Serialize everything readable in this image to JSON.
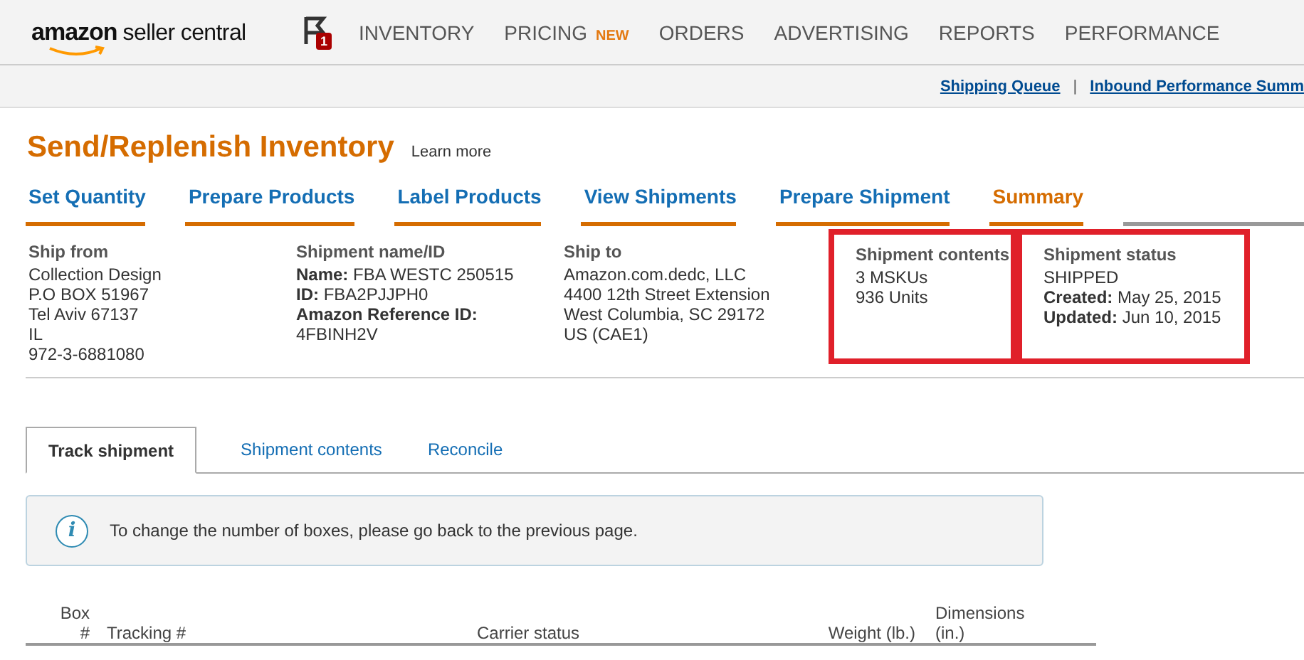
{
  "header": {
    "logo_main": "amazon",
    "logo_sub": "seller central",
    "flag_badge": "1",
    "nav": [
      {
        "label": "INVENTORY"
      },
      {
        "label": "PRICING",
        "badge": "NEW"
      },
      {
        "label": "ORDERS"
      },
      {
        "label": "ADVERTISING"
      },
      {
        "label": "REPORTS"
      },
      {
        "label": "PERFORMANCE"
      }
    ],
    "links": [
      "Shipping Queue",
      "Inbound Performance Summ"
    ],
    "link_separator": "|"
  },
  "page": {
    "title": "Send/Replenish Inventory",
    "learn_more": "Learn more"
  },
  "steps": [
    {
      "label": "Set Quantity",
      "selected": false
    },
    {
      "label": "Prepare Products",
      "selected": false
    },
    {
      "label": "Label Products",
      "selected": false
    },
    {
      "label": "View Shipments",
      "selected": false
    },
    {
      "label": "Prepare Shipment",
      "selected": false
    },
    {
      "label": "Summary",
      "selected": true
    }
  ],
  "info": [
    {
      "heading": "Ship from",
      "highlighted": false,
      "lines": [
        "Collection Design",
        "P.O BOX 51967",
        "Tel Aviv 67137",
        "IL",
        "972-3-6881080"
      ]
    },
    {
      "heading": "Shipment name/ID",
      "highlighted": false,
      "lines": [
        "**Name:** FBA WESTC 250515",
        "**ID:** FBA2PJJPH0",
        "**Amazon Reference ID:**",
        "4FBINH2V"
      ]
    },
    {
      "heading": "Ship to",
      "highlighted": false,
      "lines": [
        "Amazon.com.dedc, LLC",
        "4400 12th Street Extension",
        "West Columbia, SC 29172",
        "US (CAE1)"
      ]
    },
    {
      "heading": "Shipment contents",
      "highlighted": true,
      "lines": [
        "3 MSKUs",
        "936 Units"
      ]
    },
    {
      "heading": "Shipment status",
      "highlighted": true,
      "lines": [
        "SHIPPED",
        "**Created:** May 25, 2015",
        "**Updated:** Jun 10, 2015"
      ]
    }
  ],
  "tabs": [
    {
      "label": "Track shipment",
      "selected": true
    },
    {
      "label": "Shipment contents",
      "selected": false
    },
    {
      "label": "Reconcile",
      "selected": false
    }
  ],
  "notice": {
    "icon": "i",
    "text": "To change the number of boxes, please go back to the previous page."
  },
  "table": {
    "columns": [
      [
        "Box",
        "#"
      ],
      [
        "Tracking #"
      ],
      [
        "Carrier status"
      ],
      [
        "Weight (lb.)"
      ],
      [
        "Dimensions",
        "(in.)"
      ]
    ]
  }
}
